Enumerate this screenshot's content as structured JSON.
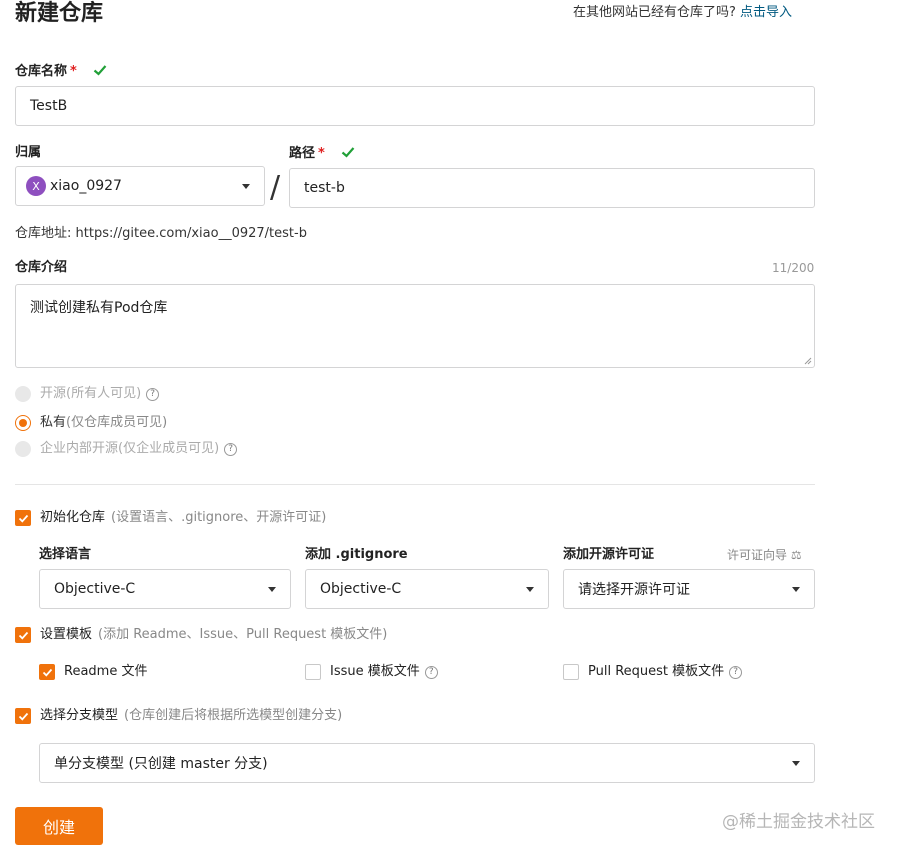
{
  "page_title": "新建仓库",
  "import": {
    "question": "在其他网站已经有仓库了吗?",
    "link": "点击导入"
  },
  "repo_name": {
    "label": "仓库名称",
    "required": "*",
    "value": "TestB"
  },
  "owner": {
    "label": "归属",
    "avatar_letter": "X",
    "value": "xiao_0927"
  },
  "separator": "/",
  "path": {
    "label": "路径",
    "required": "*",
    "value": "test-b"
  },
  "address": {
    "label": "仓库地址:",
    "url": "https://gitee.com/xiao__0927/test-b"
  },
  "description": {
    "label": "仓库介绍",
    "counter": "11/200",
    "value": "测试创建私有Pod仓库"
  },
  "visibility": {
    "open": {
      "label": "开源",
      "hint": "(所有人可见)",
      "selected": false,
      "disabled": true
    },
    "private": {
      "label": "私有",
      "hint": "(仅仓库成员可见)",
      "selected": true,
      "disabled": false
    },
    "enterprise": {
      "label": "企业内部开源",
      "hint": "(仅企业成员可见)",
      "selected": false,
      "disabled": true
    }
  },
  "init_repo": {
    "label": "初始化仓库",
    "hint": "(设置语言、.gitignore、开源许可证)",
    "checked": true
  },
  "language": {
    "label": "选择语言",
    "value": "Objective-C"
  },
  "gitignore": {
    "label": "添加 .gitignore",
    "value": "Objective-C"
  },
  "license": {
    "label": "添加开源许可证",
    "guide": "许可证向导",
    "placeholder": "请选择开源许可证"
  },
  "template": {
    "label": "设置模板",
    "hint": "(添加 Readme、Issue、Pull Request 模板文件)",
    "checked": true
  },
  "template_files": {
    "readme": {
      "label": "Readme 文件",
      "checked": true
    },
    "issue": {
      "label": "Issue 模板文件",
      "checked": false
    },
    "pr": {
      "label": "Pull Request 模板文件",
      "checked": false
    }
  },
  "branch_model": {
    "label": "选择分支模型",
    "hint": "(仓库创建后将根据所选模型创建分支)",
    "checked": true,
    "value": "单分支模型 (只创建 master 分支)"
  },
  "create_button": "创建",
  "watermark": "@稀土掘金技术社区",
  "colors": {
    "accent": "#f0720b",
    "success": "#21a038",
    "link": "#005980"
  }
}
